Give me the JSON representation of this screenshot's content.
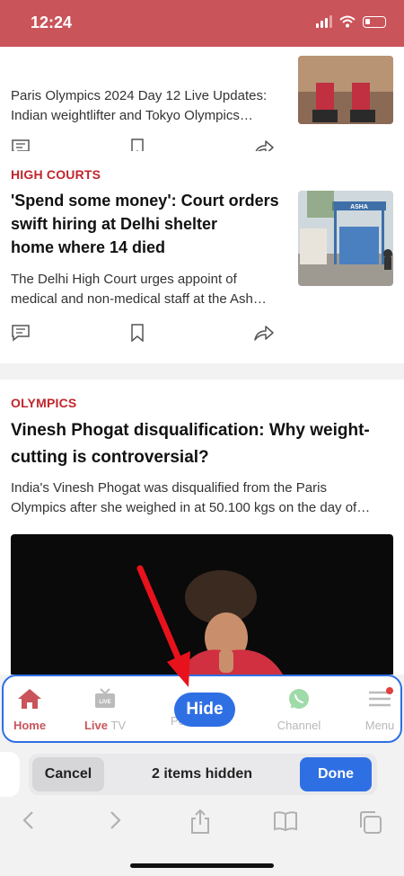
{
  "status_bar": {
    "time": "12:24"
  },
  "articles": [
    {
      "category": "",
      "headline": "",
      "summary_lines": [
        "Paris Olympics 2024 Day 12 Live Updates:",
        "Indian weightlifter and Tokyo Olympics…"
      ]
    },
    {
      "category": "HIGH COURTS",
      "headline_lines": [
        "'Spend some money': Court orders",
        "swift hiring at Delhi shelter",
        "home where 14 died"
      ],
      "summary_lines": [
        "The Delhi High Court urges appoint of",
        "medical and non-medical staff at the Ash…"
      ],
      "thumb_sign": "ASHA"
    },
    {
      "category": "OLYMPICS",
      "headline_lines": [
        "Vinesh Phogat disqualification: Why weight-",
        "cutting is controversial?"
      ],
      "summary_lines": [
        "India's Vinesh Phogat was disqualified from the Paris",
        "Olympics after she weighed in at 50.100 kgs on the day of…"
      ]
    }
  ],
  "bottom_nav": {
    "tabs": [
      {
        "id": "home",
        "label": "Home",
        "active": true
      },
      {
        "id": "livetv",
        "label": "Live TV",
        "live_part": "Live",
        "tv_part": " TV"
      },
      {
        "id": "personalise",
        "label": "Pe"
      },
      {
        "id": "channel",
        "label": "Channel"
      },
      {
        "id": "menu",
        "label": "Menu"
      }
    ],
    "hide_button": "Hide"
  },
  "hide_toolbar": {
    "cancel": "Cancel",
    "status": "2 items hidden",
    "done": "Done"
  },
  "colors": {
    "brand": "#c9545a",
    "accent": "#2f6fe4",
    "category": "#c0262d"
  }
}
